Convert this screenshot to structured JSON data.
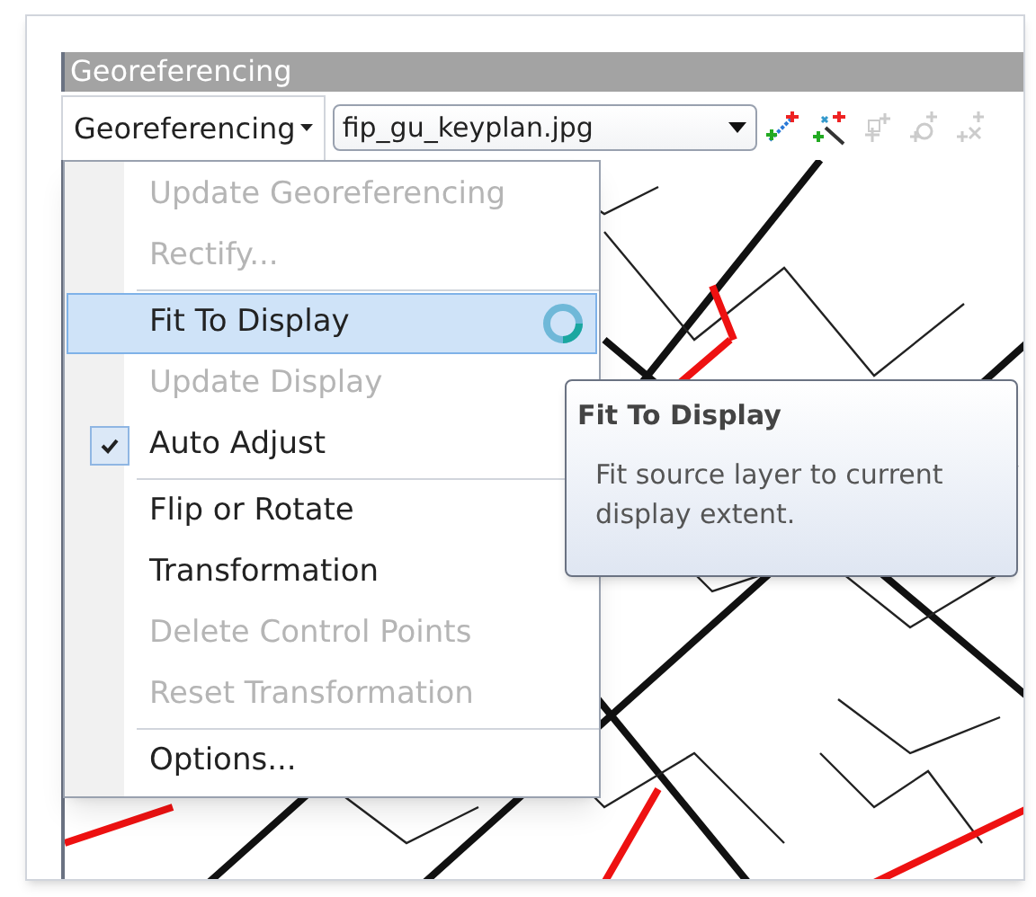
{
  "window": {
    "title": "Georeferencing"
  },
  "toolbar": {
    "menu_button": {
      "label": "Georeferencing",
      "expanded": true
    },
    "layer_dropdown": {
      "value": "fip_gu_keyplan.jpg"
    },
    "tools": [
      {
        "kind": "add-points",
        "disabled": false
      },
      {
        "kind": "auto-points",
        "disabled": false
      },
      {
        "kind": "select-points",
        "disabled": true
      },
      {
        "kind": "zoom-points",
        "disabled": true
      },
      {
        "kind": "delete-points",
        "disabled": true
      }
    ]
  },
  "menu": {
    "busy": true,
    "items": [
      {
        "kind": "item",
        "label": "Update Georeferencing",
        "disabled": true,
        "selected": false,
        "checked": false
      },
      {
        "kind": "item",
        "label": "Rectify...",
        "disabled": true,
        "selected": false,
        "checked": false
      },
      {
        "kind": "separator"
      },
      {
        "kind": "item",
        "label": "Fit To Display",
        "disabled": false,
        "selected": true,
        "checked": false
      },
      {
        "kind": "item",
        "label": "Update Display",
        "disabled": true,
        "selected": false,
        "checked": false
      },
      {
        "kind": "item",
        "label": "Auto Adjust",
        "disabled": false,
        "selected": false,
        "checked": true
      },
      {
        "kind": "separator"
      },
      {
        "kind": "item",
        "label": "Flip or Rotate",
        "disabled": false,
        "selected": false,
        "checked": false
      },
      {
        "kind": "item",
        "label": "Transformation",
        "disabled": false,
        "selected": false,
        "checked": false
      },
      {
        "kind": "item",
        "label": "Delete Control Points",
        "disabled": true,
        "selected": false,
        "checked": false
      },
      {
        "kind": "item",
        "label": "Reset Transformation",
        "disabled": true,
        "selected": false,
        "checked": false
      },
      {
        "kind": "separator"
      },
      {
        "kind": "item",
        "label": "Options...",
        "disabled": false,
        "selected": false,
        "checked": false
      }
    ]
  },
  "tooltip": {
    "title": "Fit To Display",
    "text": "Fit source layer to current display extent."
  }
}
